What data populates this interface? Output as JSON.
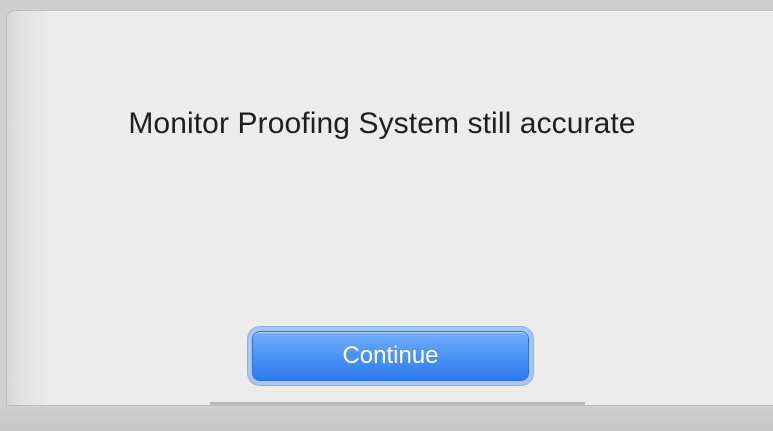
{
  "dialog": {
    "message": "Monitor Proofing System still accurate",
    "continue_label": "Continue"
  },
  "colors": {
    "dialog_background": "#ececec",
    "button_accent": "#4f95f6",
    "button_text": "#ffffff",
    "message_text": "#1e1e1e"
  }
}
